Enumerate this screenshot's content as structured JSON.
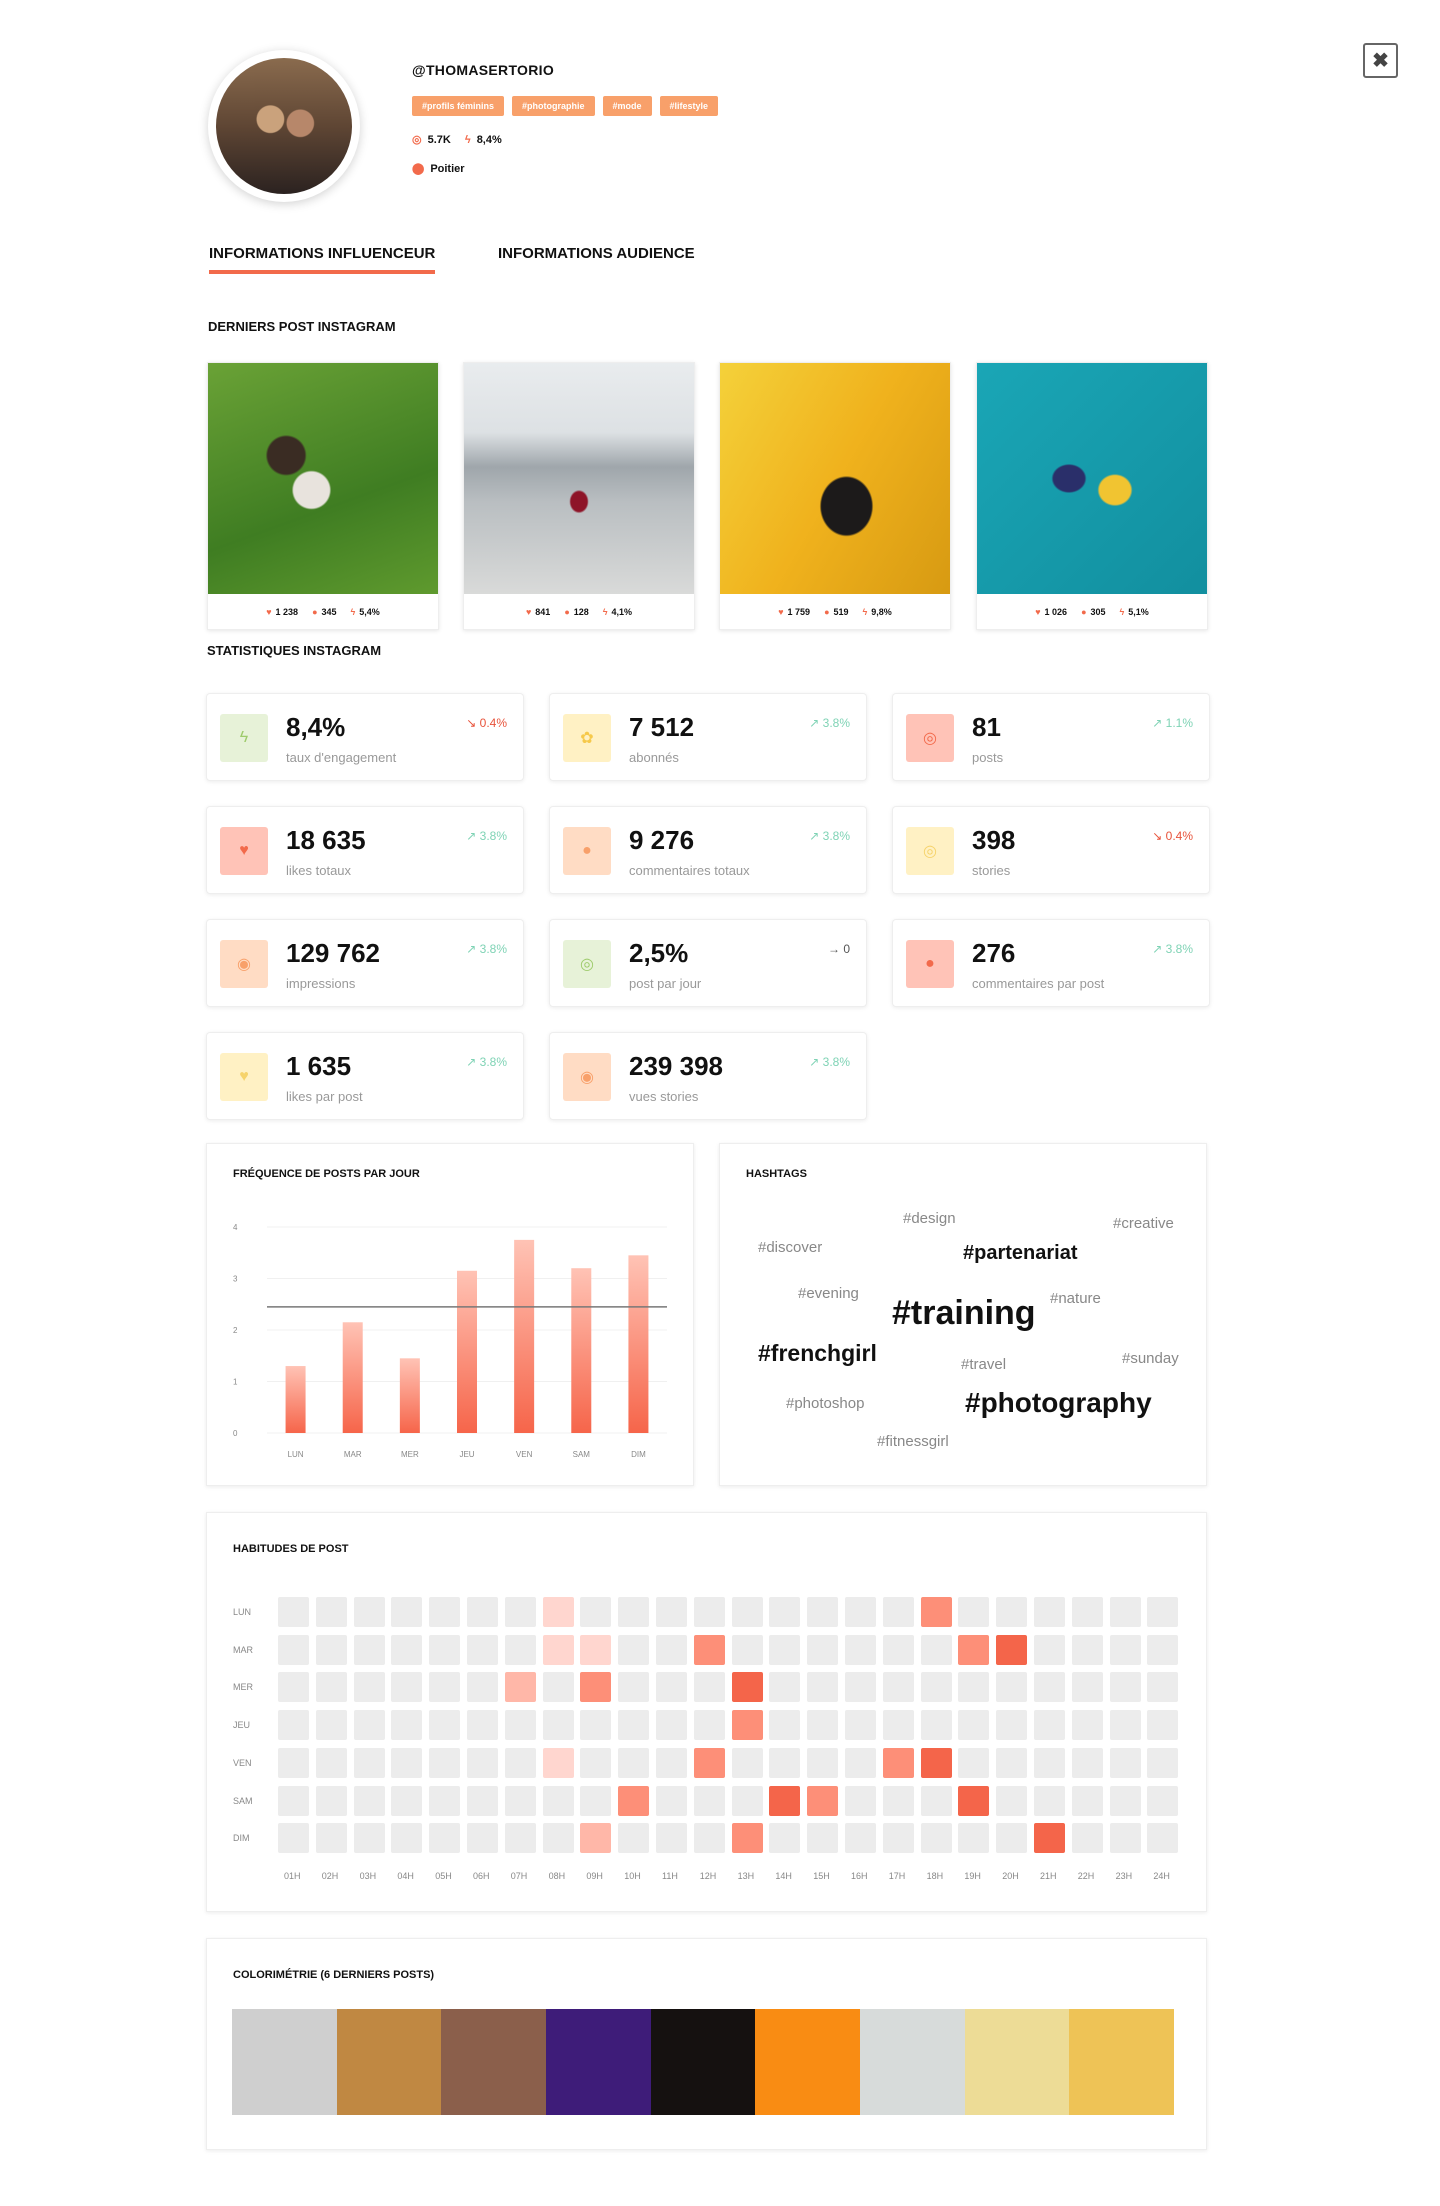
{
  "close_icon": "close-icon",
  "profile": {
    "handle": "@THOMASERTORIO",
    "tags": [
      "#profils féminins",
      "#photographie",
      "#mode",
      "#lifestyle"
    ],
    "followers": "5.7K",
    "engagement": "8,4%",
    "location": "Poitier"
  },
  "tabs": [
    "INFORMATIONS INFLUENCEUR",
    "INFORMATIONS AUDIENCE"
  ],
  "posts_section": "DERNIERS POST INSTAGRAM",
  "posts": [
    {
      "likes": "1 238",
      "comments": "345",
      "engagement": "5,4%"
    },
    {
      "likes": "841",
      "comments": "128",
      "engagement": "4,1%"
    },
    {
      "likes": "1 759",
      "comments": "519",
      "engagement": "9,8%"
    },
    {
      "likes": "1 026",
      "comments": "305",
      "engagement": "5,1%"
    }
  ],
  "stats_section": "STATISTIQUES INSTAGRAM",
  "stats": [
    {
      "value": "8,4%",
      "label": "taux d'engagement",
      "trend": "0.4%",
      "dir": "down",
      "icon": "bolt-icon",
      "bg": "#e7f2d8",
      "fg": "#9ecb6b"
    },
    {
      "value": "7 512",
      "label": "abonnés",
      "trend": "3.8%",
      "dir": "up",
      "icon": "paw-icon",
      "bg": "#fff1c4",
      "fg": "#f6c94b"
    },
    {
      "value": "81",
      "label": "posts",
      "trend": "1.1%",
      "dir": "up",
      "icon": "instagram-icon",
      "bg": "#ffc3b7",
      "fg": "#f26a4b"
    },
    {
      "value": "18 635",
      "label": "likes totaux",
      "trend": "3.8%",
      "dir": "up",
      "icon": "heart-icon",
      "bg": "#ffc3b7",
      "fg": "#f26a4b"
    },
    {
      "value": "9 276",
      "label": "commentaires totaux",
      "trend": "3.8%",
      "dir": "up",
      "icon": "comment-icon",
      "bg": "#ffdcc4",
      "fg": "#f8a06a"
    },
    {
      "value": "398",
      "label": "stories",
      "trend": "0.4%",
      "dir": "down",
      "icon": "instagram-icon",
      "bg": "#fff1c4",
      "fg": "#f6d36b"
    },
    {
      "value": "129 762",
      "label": "impressions",
      "trend": "3.8%",
      "dir": "up",
      "icon": "eye-icon",
      "bg": "#ffdcc4",
      "fg": "#f8a06a"
    },
    {
      "value": "2,5%",
      "label": "post par jour",
      "trend": "0",
      "dir": "flat",
      "icon": "instagram-icon",
      "bg": "#e7f2d8",
      "fg": "#9ecb6b"
    },
    {
      "value": "276",
      "label": "commentaires par post",
      "trend": "3.8%",
      "dir": "up",
      "icon": "comment-icon",
      "bg": "#ffc3b7",
      "fg": "#f26a4b"
    },
    {
      "value": "1 635",
      "label": "likes par post",
      "trend": "3.8%",
      "dir": "up",
      "icon": "heart-icon",
      "bg": "#fff1c4",
      "fg": "#f6d36b"
    },
    {
      "value": "239 398",
      "label": "vues stories",
      "trend": "3.8%",
      "dir": "up",
      "icon": "eye-icon",
      "bg": "#ffdcc4",
      "fg": "#f8a06a"
    }
  ],
  "freq_title": "FRÉQUENCE DE POSTS PAR JOUR",
  "chart_data": {
    "type": "bar",
    "title": "FRÉQUENCE DE POSTS PAR JOUR",
    "categories": [
      "LUN",
      "MAR",
      "MER",
      "JEU",
      "VEN",
      "SAM",
      "DIM"
    ],
    "values": [
      1.3,
      2.15,
      1.45,
      3.15,
      3.75,
      3.2,
      3.45
    ],
    "ylim": [
      0,
      4
    ],
    "yticks": [
      0,
      1,
      2,
      3,
      4
    ],
    "average_line": 2.45,
    "grid": true
  },
  "hashtags_title": "HASHTAGS",
  "hashtags": [
    "#design",
    "#creative",
    "#discover",
    "#partenariat",
    "#evening",
    "#nature",
    "#training",
    "#frenchgirl",
    "#travel",
    "#sunday",
    "#photoshop",
    "#photography",
    "#fitnessgirl"
  ],
  "habits_title": "HABITUDES DE POST",
  "habits": {
    "days": [
      "LUN",
      "MAR",
      "MER",
      "JEU",
      "VEN",
      "SAM",
      "DIM"
    ],
    "hours": [
      "01H",
      "02H",
      "03H",
      "04H",
      "05H",
      "06H",
      "07H",
      "08H",
      "09H",
      "10H",
      "11H",
      "12H",
      "13H",
      "14H",
      "15H",
      "16H",
      "17H",
      "18H",
      "19H",
      "20H",
      "21H",
      "22H",
      "23H",
      "24H"
    ],
    "levels": [
      [
        0,
        0,
        0,
        0,
        0,
        0,
        0,
        1,
        0,
        0,
        0,
        0,
        0,
        0,
        0,
        0,
        0,
        3,
        0,
        0,
        0,
        0,
        0,
        0
      ],
      [
        0,
        0,
        0,
        0,
        0,
        0,
        0,
        1,
        1,
        0,
        0,
        3,
        0,
        0,
        0,
        0,
        0,
        0,
        3,
        4,
        0,
        0,
        0,
        0
      ],
      [
        0,
        0,
        0,
        0,
        0,
        0,
        2,
        0,
        3,
        0,
        0,
        0,
        4,
        0,
        0,
        0,
        0,
        0,
        0,
        0,
        0,
        0,
        0,
        0
      ],
      [
        0,
        0,
        0,
        0,
        0,
        0,
        0,
        0,
        0,
        0,
        0,
        0,
        3,
        0,
        0,
        0,
        0,
        0,
        0,
        0,
        0,
        0,
        0,
        0
      ],
      [
        0,
        0,
        0,
        0,
        0,
        0,
        0,
        1,
        0,
        0,
        0,
        3,
        0,
        0,
        0,
        0,
        3,
        4,
        0,
        0,
        0,
        0,
        0,
        0
      ],
      [
        0,
        0,
        0,
        0,
        0,
        0,
        0,
        0,
        0,
        3,
        0,
        0,
        0,
        4,
        3,
        0,
        0,
        0,
        4,
        0,
        0,
        0,
        0,
        0
      ],
      [
        0,
        0,
        0,
        0,
        0,
        0,
        0,
        0,
        2,
        0,
        0,
        0,
        3,
        0,
        0,
        0,
        0,
        0,
        0,
        0,
        4,
        0,
        0,
        0
      ]
    ]
  },
  "level_colors": [
    "#ececec",
    "#ffd6cf",
    "#ffb7a8",
    "#fd8f78",
    "#f4654a"
  ],
  "colors_title": "COLORIMÉTRIE (6 DERNIERS POSTS)",
  "palette": [
    "#cfcfcf",
    "#c08842",
    "#8b5f4b",
    "#3e1c79",
    "#151110",
    "#f98c13",
    "#d7dbda",
    "#eddc96",
    "#eec356"
  ]
}
